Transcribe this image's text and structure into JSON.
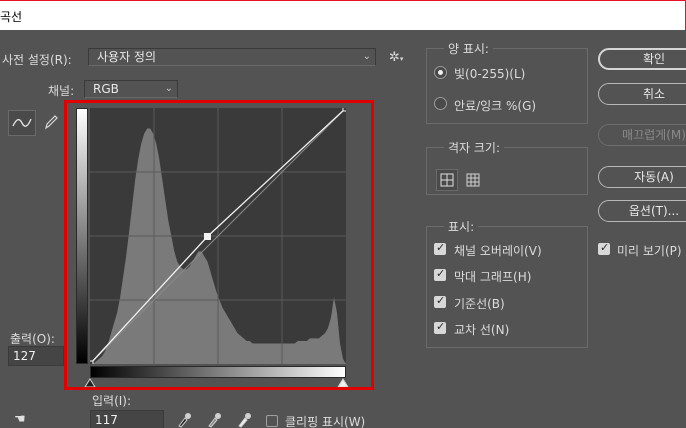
{
  "window": {
    "title": "곡선"
  },
  "preset": {
    "label": "사전 설정(R):",
    "value": "사용자 정의"
  },
  "channel": {
    "label": "채널:",
    "value": "RGB"
  },
  "output": {
    "label": "출력(O):",
    "value": "127"
  },
  "input": {
    "label": "입력(I):",
    "value": "117"
  },
  "clipping": {
    "label": "클리핑 표시(W)",
    "checked": false
  },
  "show_amount": {
    "title": "양 표시:",
    "options": [
      {
        "label": "빛(0-255)(L)",
        "selected": true
      },
      {
        "label": "안료/잉크 %(G)",
        "selected": false
      }
    ]
  },
  "grid_size": {
    "title": "격자 크기:"
  },
  "show": {
    "title": "표시:",
    "items": [
      {
        "label": "채널 오버레이(V)",
        "checked": true
      },
      {
        "label": "막대 그래프(H)",
        "checked": true
      },
      {
        "label": "기준선(B)",
        "checked": true
      },
      {
        "label": "교차 선(N)",
        "checked": true
      }
    ]
  },
  "buttons": {
    "ok": "확인",
    "cancel": "취소",
    "smooth": "매끄럽게(M)",
    "auto": "자동(A)",
    "options": "옵션(T)..."
  },
  "preview": {
    "label": "미리 보기(P)",
    "checked": true
  },
  "curve": {
    "points": [
      [
        0,
        0
      ],
      [
        117,
        127
      ],
      [
        255,
        255
      ]
    ]
  },
  "histogram": [
    0,
    0,
    1,
    2,
    3,
    5,
    8,
    12,
    16,
    20,
    26,
    34,
    42,
    52,
    62,
    72,
    80,
    86,
    90,
    92,
    92,
    90,
    86,
    80,
    72,
    64,
    56,
    50,
    44,
    40,
    38,
    37,
    37,
    38,
    40,
    42,
    44,
    44,
    42,
    40,
    36,
    32,
    28,
    25,
    22,
    20,
    18,
    16,
    14,
    12,
    11,
    10,
    9,
    9,
    8,
    8,
    8,
    8,
    8,
    8,
    8,
    8,
    8,
    8,
    8,
    8,
    8,
    8,
    8,
    9,
    9,
    9,
    9,
    10,
    10,
    10,
    10,
    11,
    12,
    14,
    18,
    26,
    20,
    8,
    2,
    0
  ],
  "colors": {
    "accent_frame": "#e00000",
    "panel_bg": "#535353"
  }
}
